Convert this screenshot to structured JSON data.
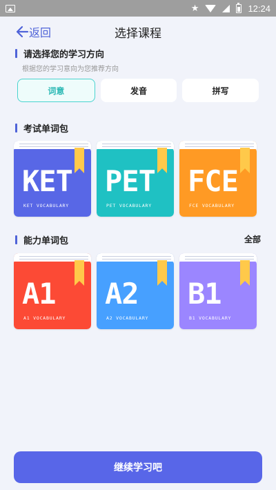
{
  "status_bar": {
    "time": "12:24"
  },
  "header": {
    "back_label": "返回",
    "title": "选择课程"
  },
  "direction": {
    "title": "请选择您的学习方向",
    "hint": "根据您的学习意向为您推荐方向",
    "tabs": [
      {
        "label": "词意",
        "active": true
      },
      {
        "label": "发音",
        "active": false
      },
      {
        "label": "拼写",
        "active": false
      }
    ]
  },
  "exam_section": {
    "title": "考试单词包",
    "books": [
      {
        "big": "KET",
        "small": "KET VOCABULARY",
        "color": "#5867e6",
        "top_color": "#4a55c7"
      },
      {
        "big": "PET",
        "small": "PET VOCABULARY",
        "color": "#1fc1c3",
        "top_color": "#169fa3"
      },
      {
        "big": "FCE",
        "small": "FCE VOCABULARY",
        "color": "#ff9a24",
        "top_color": "#e57e12"
      }
    ]
  },
  "ability_section": {
    "title": "能力单词包",
    "all_label": "全部",
    "books": [
      {
        "big": "A1",
        "small": "A1 VOCABULARY",
        "color": "#fc4a35",
        "top_color": "#d93324"
      },
      {
        "big": "A2",
        "small": "A2 VOCABULARY",
        "color": "#47a0ff",
        "top_color": "#3886dd"
      },
      {
        "big": "B1",
        "small": "B1 VOCABULARY",
        "color": "#9b86ff",
        "top_color": "#7e6ae0"
      }
    ]
  },
  "continue_label": "继续学习吧",
  "colors": {
    "accent": "#5866e8",
    "background": "#f1f3fa",
    "tab_active": "#49d3cf"
  }
}
